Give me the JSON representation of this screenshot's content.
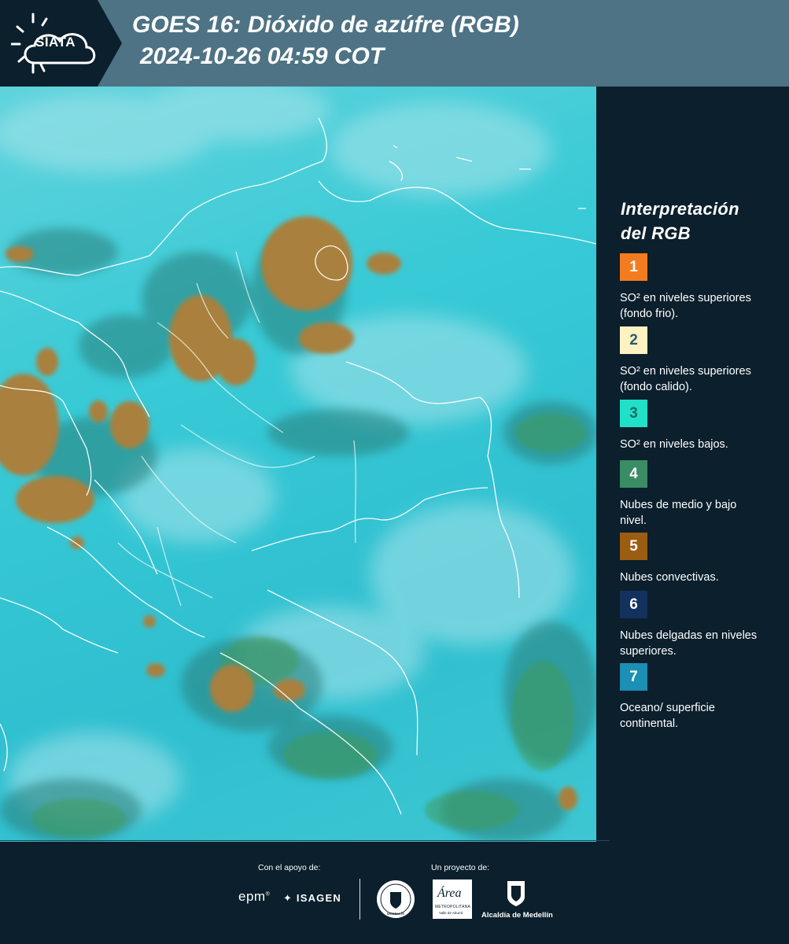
{
  "header": {
    "logo_text": "SIATA",
    "title_line1": "GOES 16: Dióxido de azúfre (RGB)",
    "title_line2": "2024-10-26 04:59 COT"
  },
  "legend": {
    "title_line1": "Interpretación",
    "title_line2": "del RGB",
    "items": [
      {
        "number": "1",
        "color": "#f47c20",
        "text": "SO² en niveles superiores (fondo frio)."
      },
      {
        "number": "2",
        "color": "#fdf3c2",
        "text": "SO² en niveles superiores (fondo calido)."
      },
      {
        "number": "3",
        "color": "#20e0c8",
        "text": "SO² en niveles bajos."
      },
      {
        "number": "4",
        "color": "#3a8c64",
        "text": "Nubes de medio y bajo nivel."
      },
      {
        "number": "5",
        "color": "#9a5d12",
        "text": "Nubes convectivas."
      },
      {
        "number": "6",
        "color": "#13315d",
        "text": "Nubes delgadas en niveles superiores."
      },
      {
        "number": "7",
        "color": "#1b8fb4",
        "text": "Oceano/ superficie continental."
      }
    ]
  },
  "footer": {
    "support_label": "Con el apoyo de:",
    "project_label": "Un proyecto de:",
    "sponsor_epm": "epm",
    "sponsor_isagen": "ISAGEN",
    "sponsor_area_1": "Área",
    "sponsor_area_2": "METROPOLITANA",
    "sponsor_area_3": "Valle de Aburrá",
    "sponsor_alcaldia": "Alcaldía de Medellín",
    "seal_text": "MEDELLÍN"
  },
  "colors": {
    "background": "#0b1f2c",
    "header": "#4d7385",
    "map_base": "#38cad6",
    "cloud_brown": "#a9803e",
    "cloud_green": "#2e8a62"
  }
}
